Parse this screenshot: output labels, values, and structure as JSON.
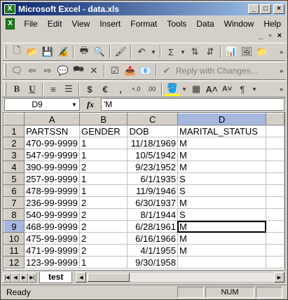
{
  "window": {
    "title": "Microsoft Excel - data.xls",
    "app_icon": "X",
    "buttons": {
      "minimize": "_",
      "maximize": "□",
      "close": "×"
    }
  },
  "menubar": {
    "items": [
      "File",
      "Edit",
      "View",
      "Insert",
      "Format",
      "Tools",
      "Data",
      "Window",
      "Help"
    ],
    "doc_controls": {
      "minimize": "_",
      "restore": "▫",
      "close": "×"
    }
  },
  "toolbar2": {
    "reply_label": "Reply with Changes..."
  },
  "formula": {
    "cell_ref": "D9",
    "fx_label": "fx",
    "value": "'M"
  },
  "sheet": {
    "columns": [
      "A",
      "B",
      "C",
      "D"
    ],
    "selected_column": "D",
    "selected_row": 9,
    "rows": [
      {
        "n": "1",
        "a": "PARTSSN",
        "b": "GENDER",
        "c": "DOB",
        "d": "MARITAL_STATUS"
      },
      {
        "n": "2",
        "a": "470-99-9999",
        "b": "1",
        "c": "11/18/1969",
        "d": "M"
      },
      {
        "n": "3",
        "a": "547-99-9999",
        "b": "1",
        "c": "10/5/1942",
        "d": "M"
      },
      {
        "n": "4",
        "a": "390-99-9999",
        "b": "2",
        "c": "9/23/1952",
        "d": "M"
      },
      {
        "n": "5",
        "a": "257-99-9999",
        "b": "1",
        "c": "6/1/1935",
        "d": "S"
      },
      {
        "n": "6",
        "a": "478-99-9999",
        "b": "1",
        "c": "11/9/1946",
        "d": "S"
      },
      {
        "n": "7",
        "a": "236-99-9999",
        "b": "2",
        "c": "6/30/1937",
        "d": "M"
      },
      {
        "n": "8",
        "a": "540-99-9999",
        "b": "2",
        "c": "8/1/1944",
        "d": "S"
      },
      {
        "n": "9",
        "a": "468-99-9999",
        "b": "2",
        "c": "6/28/1961",
        "d": "M"
      },
      {
        "n": "10",
        "a": "475-99-9999",
        "b": "2",
        "c": "6/16/1966",
        "d": "M"
      },
      {
        "n": "11",
        "a": "471-99-9999",
        "b": "2",
        "c": "4/1/1955",
        "d": "M"
      },
      {
        "n": "12",
        "a": "123-99-9999",
        "b": "1",
        "c": "9/30/1958",
        "d": ""
      }
    ]
  },
  "tabs": {
    "active": "test"
  },
  "status": {
    "ready": "Ready",
    "num": "NUM"
  }
}
